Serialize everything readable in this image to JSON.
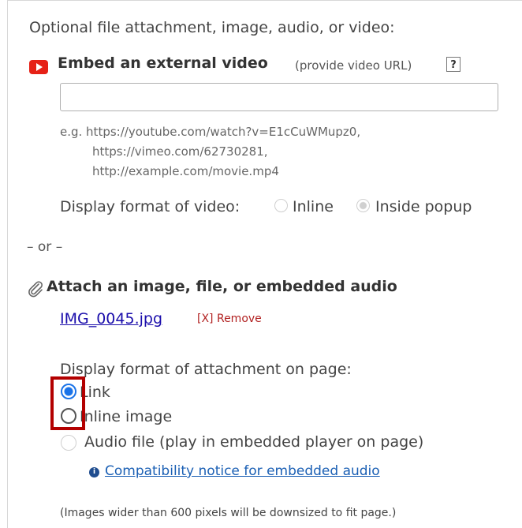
{
  "intro": "Optional file attachment, image, audio, or video:",
  "embed": {
    "title": "Embed an external video",
    "hint": "(provide video URL)",
    "help_label": "?",
    "url_value": "",
    "examples": [
      "e.g. https://youtube.com/watch?v=E1cCuWMupz0,",
      "https://vimeo.com/62730281,",
      "http://example.com/movie.mp4"
    ],
    "format_label": "Display format of video:",
    "format_options": [
      {
        "label": "Inline",
        "checked": false,
        "disabled": true
      },
      {
        "label": "Inside popup",
        "checked": true,
        "disabled": true
      }
    ]
  },
  "or_label": "– or –",
  "attach": {
    "title": "Attach an image, file, or embedded audio",
    "file_name": "IMG_0045.jpg",
    "remove_label": "[X] Remove",
    "format_label": "Display format of attachment on page:",
    "options": [
      {
        "label": "Link",
        "checked": true,
        "disabled": false
      },
      {
        "label": "Inline image",
        "checked": false,
        "disabled": false
      },
      {
        "label": "Audio file (play in embedded player on page)",
        "checked": false,
        "disabled": true
      }
    ],
    "compat_link": "Compatibility notice for embedded audio",
    "note": "(Images wider than 600 pixels will be downsized to fit page.)"
  },
  "icons": {
    "video": "youtube-play-icon",
    "attachment": "paperclip-icon",
    "info": "info-icon"
  },
  "colors": {
    "accent": "#1a73e8",
    "link": "#1a0dab",
    "remove": "#b22222",
    "highlight": "#b30000",
    "youtube": "#e62117"
  }
}
